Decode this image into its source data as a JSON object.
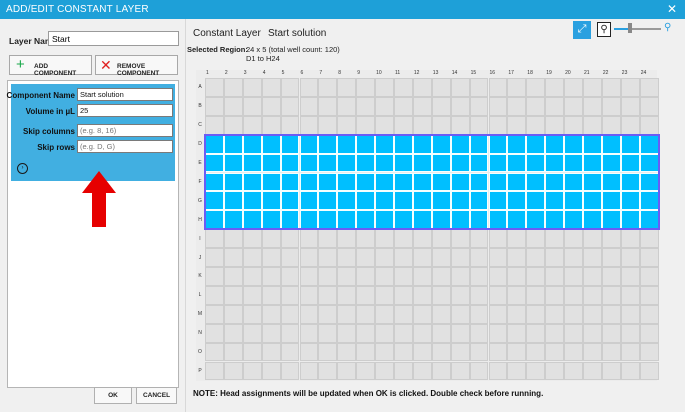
{
  "window": {
    "title": "ADD/EDIT CONSTANT LAYER",
    "close_glyph": "✕"
  },
  "left": {
    "layer_name_label": "Layer Name",
    "layer_name_value": "Start",
    "add_button": {
      "icon": "plus-icon",
      "glyph": "+",
      "label": "ADD COMPONENT"
    },
    "remove_button": {
      "icon": "x-icon",
      "glyph": "✕",
      "label": "REMOVE COMPONENT"
    },
    "component": {
      "name_label": "Component Name",
      "name_value": "Start solution",
      "volume_label": "Volume in µL",
      "volume_value": "25",
      "skip_columns_label": "Skip columns",
      "skip_columns_placeholder": "(e.g. 8, 16)",
      "skip_rows_label": "Skip rows",
      "skip_rows_placeholder": "(e.g. D, G)",
      "expand_icon": "chevron-right-circle-icon",
      "expand_glyph": "›"
    },
    "ok_label": "OK",
    "cancel_label": "CANCEL"
  },
  "right": {
    "layer_type": "Constant Layer",
    "component_title": "Start solution",
    "selected_region_label": "Selected Region:",
    "selected_region_dims": "24 x 5  (total well count: 120)",
    "selected_region_range": "D1 to H24",
    "expand_icon": "expand-icon",
    "expand_glyph": "⤢",
    "zoom_out_icon": "zoom-out-icon",
    "zoom_out_glyph": "⚲",
    "zoom_in_icon": "zoom-in-icon",
    "zoom_in_glyph": "⚲",
    "zoom_level": 0.35,
    "note": "NOTE: Head assignments will be updated when OK is clicked. Double check before running."
  },
  "plate": {
    "columns": [
      "1",
      "2",
      "3",
      "4",
      "5",
      "6",
      "7",
      "8",
      "9",
      "10",
      "11",
      "12",
      "13",
      "14",
      "15",
      "16",
      "17",
      "18",
      "19",
      "20",
      "21",
      "22",
      "23",
      "24"
    ],
    "rows": [
      "A",
      "B",
      "C",
      "D",
      "E",
      "F",
      "G",
      "H",
      "I",
      "J",
      "K",
      "L",
      "M",
      "N",
      "O",
      "P"
    ],
    "selected_rows": [
      "D",
      "E",
      "F",
      "G",
      "H"
    ]
  },
  "colors": {
    "title_bar": "#1ea0d8",
    "card": "#41afe1",
    "selected_well": "#00bfff",
    "selection_outline": "#6a5cf5",
    "arrow": "#e60000"
  }
}
